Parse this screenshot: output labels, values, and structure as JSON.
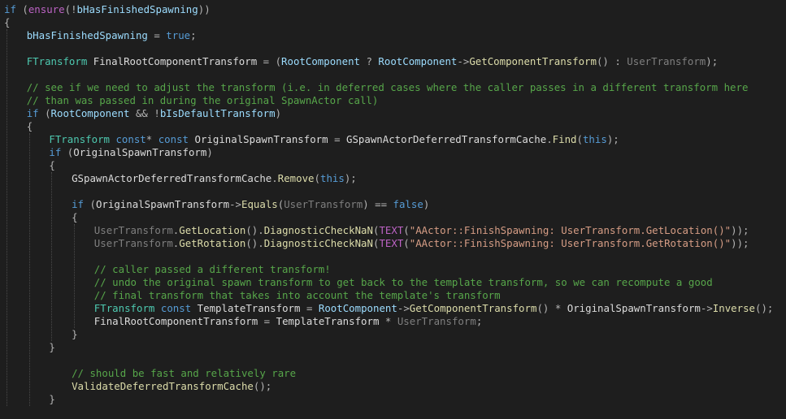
{
  "code": {
    "lines": [
      {
        "indent": 0,
        "tokens": [
          [
            "kw",
            "if"
          ],
          [
            "op",
            " ("
          ],
          [
            "mc",
            "ensure"
          ],
          [
            "op",
            "(!"
          ],
          [
            "pr",
            "bHasFinishedSpawning"
          ],
          [
            "op",
            "))"
          ]
        ]
      },
      {
        "indent": 0,
        "tokens": [
          [
            "op",
            "{"
          ]
        ]
      },
      {
        "indent": 1,
        "tokens": [
          [
            "pr",
            "bHasFinishedSpawning"
          ],
          [
            "op",
            " = "
          ],
          [
            "kw",
            "true"
          ],
          [
            "op",
            ";"
          ]
        ]
      },
      {
        "indent": 0,
        "tokens": []
      },
      {
        "indent": 1,
        "tokens": [
          [
            "ty",
            "FTransform"
          ],
          [
            "op",
            " "
          ],
          [
            "id",
            "FinalRootComponentTransform"
          ],
          [
            "op",
            " = ("
          ],
          [
            "pr",
            "RootComponent"
          ],
          [
            "op",
            " ? "
          ],
          [
            "pr",
            "RootComponent"
          ],
          [
            "op",
            "->"
          ],
          [
            "fn",
            "GetComponentTransform"
          ],
          [
            "op",
            "() : "
          ],
          [
            "pm",
            "UserTransform"
          ],
          [
            "op",
            ");"
          ]
        ]
      },
      {
        "indent": 0,
        "tokens": []
      },
      {
        "indent": 1,
        "tokens": [
          [
            "cm",
            "// see if we need to adjust the transform (i.e. in deferred cases where the caller passes in a different transform here"
          ]
        ]
      },
      {
        "indent": 1,
        "tokens": [
          [
            "cm",
            "// than was passed in during the original SpawnActor call)"
          ]
        ]
      },
      {
        "indent": 1,
        "tokens": [
          [
            "kw",
            "if"
          ],
          [
            "op",
            " ("
          ],
          [
            "pr",
            "RootComponent"
          ],
          [
            "op",
            " && !"
          ],
          [
            "pr",
            "bIsDefaultTransform"
          ],
          [
            "op",
            ")"
          ]
        ]
      },
      {
        "indent": 1,
        "tokens": [
          [
            "op",
            "{"
          ]
        ]
      },
      {
        "indent": 2,
        "tokens": [
          [
            "ty",
            "FTransform"
          ],
          [
            "op",
            " "
          ],
          [
            "kw",
            "const"
          ],
          [
            "op",
            "* "
          ],
          [
            "kw",
            "const"
          ],
          [
            "op",
            " "
          ],
          [
            "id",
            "OriginalSpawnTransform"
          ],
          [
            "op",
            " = "
          ],
          [
            "id",
            "GSpawnActorDeferredTransformCache"
          ],
          [
            "op",
            "."
          ],
          [
            "fn",
            "Find"
          ],
          [
            "op",
            "("
          ],
          [
            "kw",
            "this"
          ],
          [
            "op",
            ");"
          ]
        ]
      },
      {
        "indent": 2,
        "tokens": [
          [
            "kw",
            "if"
          ],
          [
            "op",
            " ("
          ],
          [
            "id",
            "OriginalSpawnTransform"
          ],
          [
            "op",
            ")"
          ]
        ]
      },
      {
        "indent": 2,
        "tokens": [
          [
            "op",
            "{"
          ]
        ]
      },
      {
        "indent": 3,
        "tokens": [
          [
            "id",
            "GSpawnActorDeferredTransformCache"
          ],
          [
            "op",
            "."
          ],
          [
            "fn",
            "Remove"
          ],
          [
            "op",
            "("
          ],
          [
            "kw",
            "this"
          ],
          [
            "op",
            ");"
          ]
        ]
      },
      {
        "indent": 0,
        "tokens": []
      },
      {
        "indent": 3,
        "tokens": [
          [
            "kw",
            "if"
          ],
          [
            "op",
            " ("
          ],
          [
            "id",
            "OriginalSpawnTransform"
          ],
          [
            "op",
            "->"
          ],
          [
            "fn",
            "Equals"
          ],
          [
            "op",
            "("
          ],
          [
            "pm",
            "UserTransform"
          ],
          [
            "op",
            ") == "
          ],
          [
            "kw",
            "false"
          ],
          [
            "op",
            ")"
          ]
        ]
      },
      {
        "indent": 3,
        "tokens": [
          [
            "op",
            "{"
          ]
        ]
      },
      {
        "indent": 4,
        "tokens": [
          [
            "pm",
            "UserTransform"
          ],
          [
            "op",
            "."
          ],
          [
            "fn",
            "GetLocation"
          ],
          [
            "op",
            "()."
          ],
          [
            "fn",
            "DiagnosticCheckNaN"
          ],
          [
            "op",
            "("
          ],
          [
            "mc",
            "TEXT"
          ],
          [
            "op",
            "("
          ],
          [
            "st",
            "\"AActor::FinishSpawning: UserTransform.GetLocation()\""
          ],
          [
            "op",
            "));"
          ]
        ]
      },
      {
        "indent": 4,
        "tokens": [
          [
            "pm",
            "UserTransform"
          ],
          [
            "op",
            "."
          ],
          [
            "fn",
            "GetRotation"
          ],
          [
            "op",
            "()."
          ],
          [
            "fn",
            "DiagnosticCheckNaN"
          ],
          [
            "op",
            "("
          ],
          [
            "mc",
            "TEXT"
          ],
          [
            "op",
            "("
          ],
          [
            "st",
            "\"AActor::FinishSpawning: UserTransform.GetRotation()\""
          ],
          [
            "op",
            "));"
          ]
        ]
      },
      {
        "indent": 0,
        "tokens": []
      },
      {
        "indent": 4,
        "tokens": [
          [
            "cm",
            "// caller passed a different transform!"
          ]
        ]
      },
      {
        "indent": 4,
        "tokens": [
          [
            "cm",
            "// undo the original spawn transform to get back to the template transform, so we can recompute a good"
          ]
        ]
      },
      {
        "indent": 4,
        "tokens": [
          [
            "cm",
            "// final transform that takes into account the template's transform"
          ]
        ]
      },
      {
        "indent": 4,
        "tokens": [
          [
            "ty",
            "FTransform"
          ],
          [
            "op",
            " "
          ],
          [
            "kw",
            "const"
          ],
          [
            "op",
            " "
          ],
          [
            "id",
            "TemplateTransform"
          ],
          [
            "op",
            " = "
          ],
          [
            "pr",
            "RootComponent"
          ],
          [
            "op",
            "->"
          ],
          [
            "fn",
            "GetComponentTransform"
          ],
          [
            "op",
            "() * "
          ],
          [
            "id",
            "OriginalSpawnTransform"
          ],
          [
            "op",
            "->"
          ],
          [
            "fn",
            "Inverse"
          ],
          [
            "op",
            "();"
          ]
        ]
      },
      {
        "indent": 4,
        "tokens": [
          [
            "id",
            "FinalRootComponentTransform"
          ],
          [
            "op",
            " = "
          ],
          [
            "id",
            "TemplateTransform"
          ],
          [
            "op",
            " * "
          ],
          [
            "pm",
            "UserTransform"
          ],
          [
            "op",
            ";"
          ]
        ]
      },
      {
        "indent": 3,
        "tokens": [
          [
            "op",
            "}"
          ]
        ]
      },
      {
        "indent": 2,
        "tokens": [
          [
            "op",
            "}"
          ]
        ]
      },
      {
        "indent": 0,
        "tokens": []
      },
      {
        "indent": 3,
        "tokens": [
          [
            "cm",
            "// should be fast and relatively rare"
          ]
        ]
      },
      {
        "indent": 3,
        "tokens": [
          [
            "fn",
            "ValidateDeferredTransformCache"
          ],
          [
            "op",
            "();"
          ]
        ]
      },
      {
        "indent": 2,
        "tokens": [
          [
            "op",
            "}"
          ]
        ]
      }
    ]
  },
  "colors": {
    "background": "#1e1e1e",
    "keyword": "#569cd6",
    "type": "#4ec9b0",
    "function": "#dcdcaa",
    "identifier": "#dcdcdc",
    "property": "#9cdcfe",
    "parameter": "#7f7f7f",
    "comment": "#57a64a",
    "string": "#d69d85",
    "macro": "#bd63c5"
  }
}
